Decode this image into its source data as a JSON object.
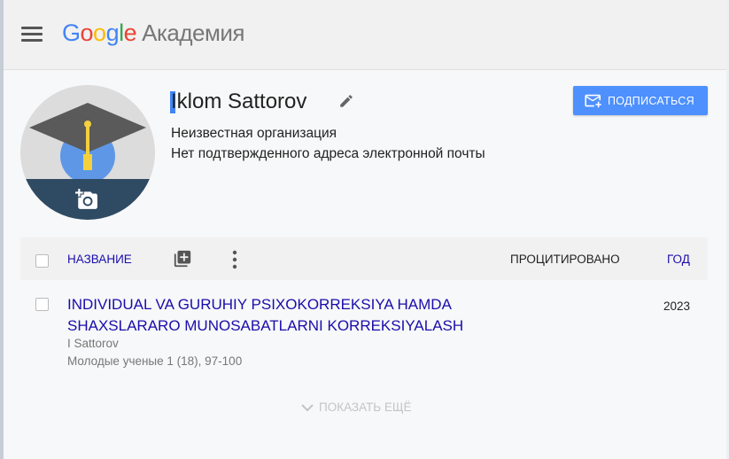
{
  "header": {
    "logo": {
      "g1": "G",
      "g2": "o",
      "g3": "o",
      "g4": "g",
      "g5": "l",
      "g6": "e"
    },
    "product": "Академия"
  },
  "profile": {
    "name": "Iklom Sattorov",
    "affiliation": "Неизвестная организация",
    "email_status": "Нет подтвержденного адреса электронной почты",
    "follow_label": "ПОДПИСАТЬСЯ"
  },
  "table": {
    "columns": {
      "title": "НАЗВАНИЕ",
      "cited": "ПРОЦИТИРОВАНО",
      "year": "ГОД"
    },
    "rows": [
      {
        "title": "INDIVIDUAL VA GURUHIY PSIXOKORREKSIYA HAMDA SHAXSLARARO MUNOSABATLARNI KORREKSIYALASH",
        "authors": "I Sattorov",
        "venue": "Молодые ученые 1 (18), 97-100",
        "year": "2023"
      }
    ],
    "show_more": "ПОКАЗАТЬ ЕЩЁ"
  },
  "colors": {
    "accent_blue": "#4d90fe",
    "link": "#1a0dab",
    "google_blue": "#4285f4",
    "google_red": "#ea4335",
    "google_yellow": "#fbbc05",
    "google_green": "#34a853"
  },
  "icons": [
    "menu-icon",
    "edit-icon",
    "mail-add-icon",
    "camera-add-icon",
    "add-box-icon",
    "more-vert-icon",
    "chevron-down-icon",
    "checkbox-icon"
  ]
}
